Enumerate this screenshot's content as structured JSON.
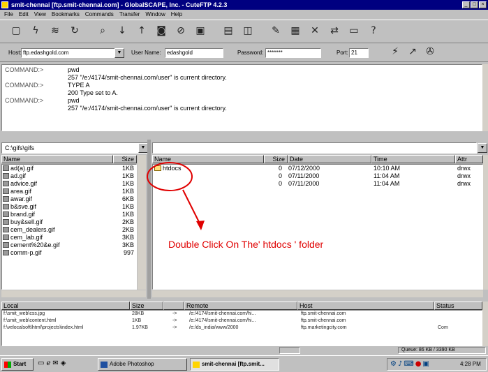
{
  "window": {
    "title": "smit-chennai [ftp.smit-chennai.com] - GlobalSCAPE, Inc. - CuteFTP 4.2.3",
    "buttons": {
      "minimize": "_",
      "maximize": "□",
      "close": "×"
    }
  },
  "menu": [
    "File",
    "Edit",
    "View",
    "Bookmarks",
    "Commands",
    "Transfer",
    "Window",
    "Help"
  ],
  "toolbar": [
    "address-book-icon",
    "quick-connect-icon",
    "disconnect-icon",
    "reconnect-icon",
    "stop-icon",
    "download-icon",
    "upload-icon",
    "find-icon",
    "refresh-icon",
    "log-icon",
    "view-icon",
    "split-view-icon",
    "rename-icon",
    "window-icon",
    "delete-icon",
    "compare-icon",
    "open-icon",
    "help-icon"
  ],
  "connection": {
    "host_label": "Host:",
    "host_value": "ftp.edashgold.com",
    "user_label": "User Name:",
    "user_value": "edashgold",
    "password_label": "Password:",
    "password_value": "*******",
    "port_label": "Port:",
    "port_value": "21"
  },
  "log": [
    {
      "k": "COMMAND:>",
      "v": "pwd"
    },
    {
      "k": "",
      "v": "257 \"/e:/4174/smit-chennai.com/user\" is current directory."
    },
    {
      "k": "COMMAND:>",
      "v": "TYPE A"
    },
    {
      "k": "",
      "v": "200 Type set to A."
    },
    {
      "k": "COMMAND:>",
      "v": "pwd"
    },
    {
      "k": "",
      "v": "257 \"/e:/4174/smit-chennai.com/user\" is current directory."
    }
  ],
  "local": {
    "path": "C:\\gifs\\gifs",
    "col_name": "Name",
    "col_size": "Size",
    "files": [
      {
        "name": "ad(a).gif",
        "size": "1KB"
      },
      {
        "name": "ad.gif",
        "size": "1KB"
      },
      {
        "name": "advice.gif",
        "size": "1KB"
      },
      {
        "name": "area.gif",
        "size": "1KB"
      },
      {
        "name": "awar.gif",
        "size": "6KB"
      },
      {
        "name": "b&sve.gif",
        "size": "1KB"
      },
      {
        "name": "brand.gif",
        "size": "1KB"
      },
      {
        "name": "buy&sell.gif",
        "size": "2KB"
      },
      {
        "name": "cem_dealers.gif",
        "size": "2KB"
      },
      {
        "name": "cem_lab.gif",
        "size": "3KB"
      },
      {
        "name": "cement%20&e.gif",
        "size": "3KB"
      },
      {
        "name": "comm-p.gif",
        "size": "997"
      }
    ]
  },
  "remote": {
    "col_name": "Name",
    "col_size": "Size",
    "col_date": "Date",
    "col_time": "Time",
    "col_attr": "Attr",
    "files": [
      {
        "name": "htdocs",
        "size": "0",
        "date": "07/12/2000",
        "time": "10:10 AM",
        "attr": "drwx"
      },
      {
        "name": "",
        "size": "0",
        "date": "07/11/2000",
        "time": "11:04 AM",
        "attr": "drwx"
      },
      {
        "name": "",
        "size": "0",
        "date": "07/11/2000",
        "time": "11:04 AM",
        "attr": "drwx"
      }
    ]
  },
  "annotation": "Double Click On The' htdocs ' folder",
  "queue": {
    "col_local": "Local",
    "col_size": "Size",
    "col_remote": "Remote",
    "col_host": "Host",
    "col_status": "Status",
    "rows": [
      {
        "local": "f:\\smit_web\\css.jpg",
        "size": "28KB",
        "arrow": "->",
        "remote": "/e:/4174/smit-chennai.com/hi...",
        "host": "ftp.smit-chennai.com",
        "status": ""
      },
      {
        "local": "f:\\smit_web\\content.html",
        "size": "1KB",
        "arrow": "->",
        "remote": "/e:/4174/smit-chennai.com/hi...",
        "host": "ftp.smit-chennai.com",
        "status": ""
      },
      {
        "local": "f:\\velocalsoft\\html\\projects\\index.html",
        "size": "1.97KB",
        "arrow": "->",
        "remote": "/e:/ds_india/www/2000",
        "host": "ftp.marketingcity.com",
        "status": "Com"
      }
    ]
  },
  "status": {
    "queue": "Queue: 86 KB / 3390 KB"
  },
  "taskbar": {
    "start": "Start",
    "tasks": [
      "Adobe Photoshop",
      "smit-chennai [ftp.smit..."
    ],
    "clock": "4:28 PM"
  }
}
